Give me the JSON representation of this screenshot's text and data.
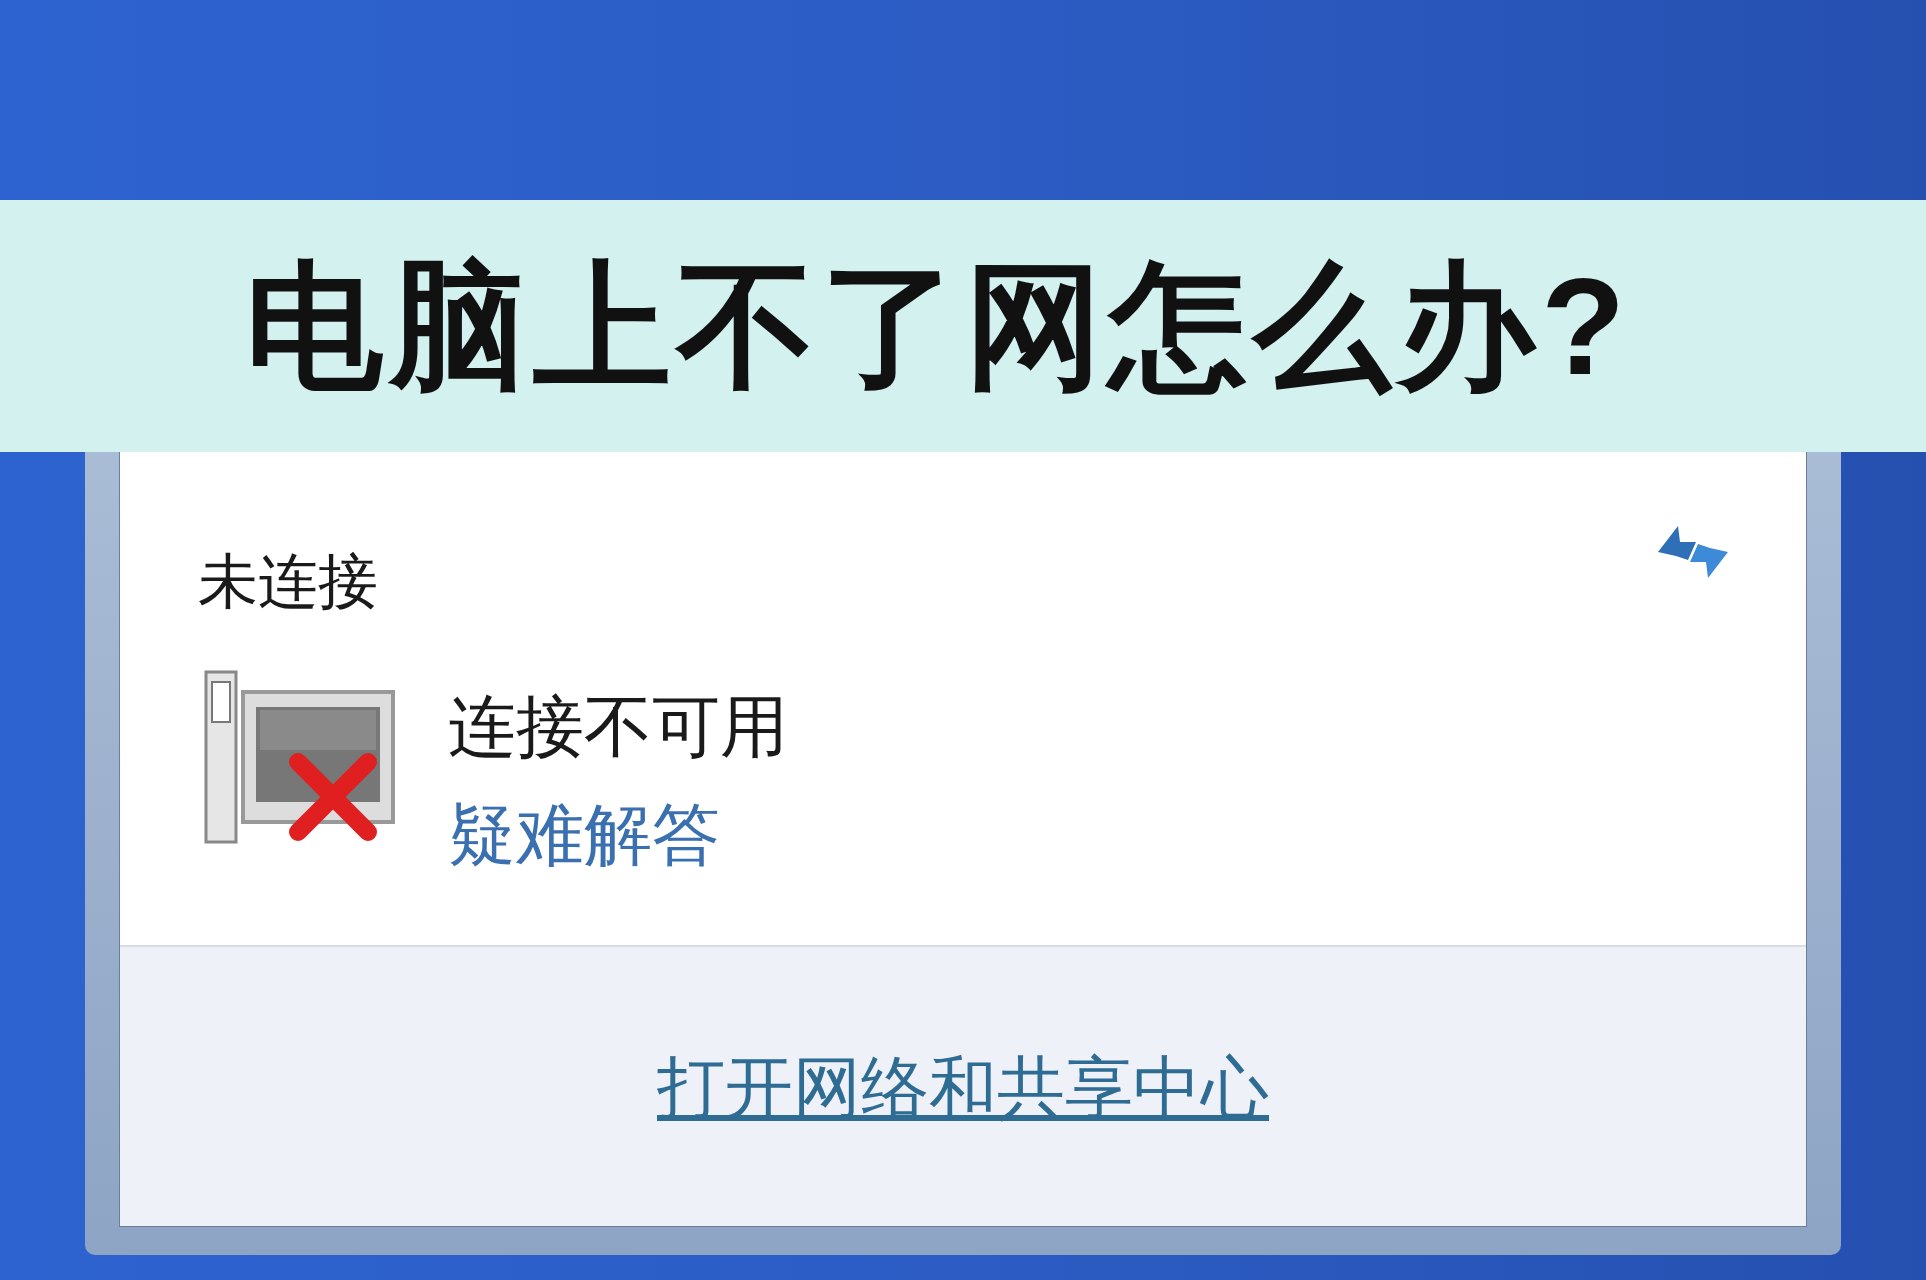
{
  "banner": {
    "title": "电脑上不了网怎么办?"
  },
  "flyout": {
    "heading": "未连接",
    "connection": {
      "status": "连接不可用",
      "link": "疑难解答",
      "connected": false
    },
    "footer_link": "打开网络和共享中心"
  }
}
